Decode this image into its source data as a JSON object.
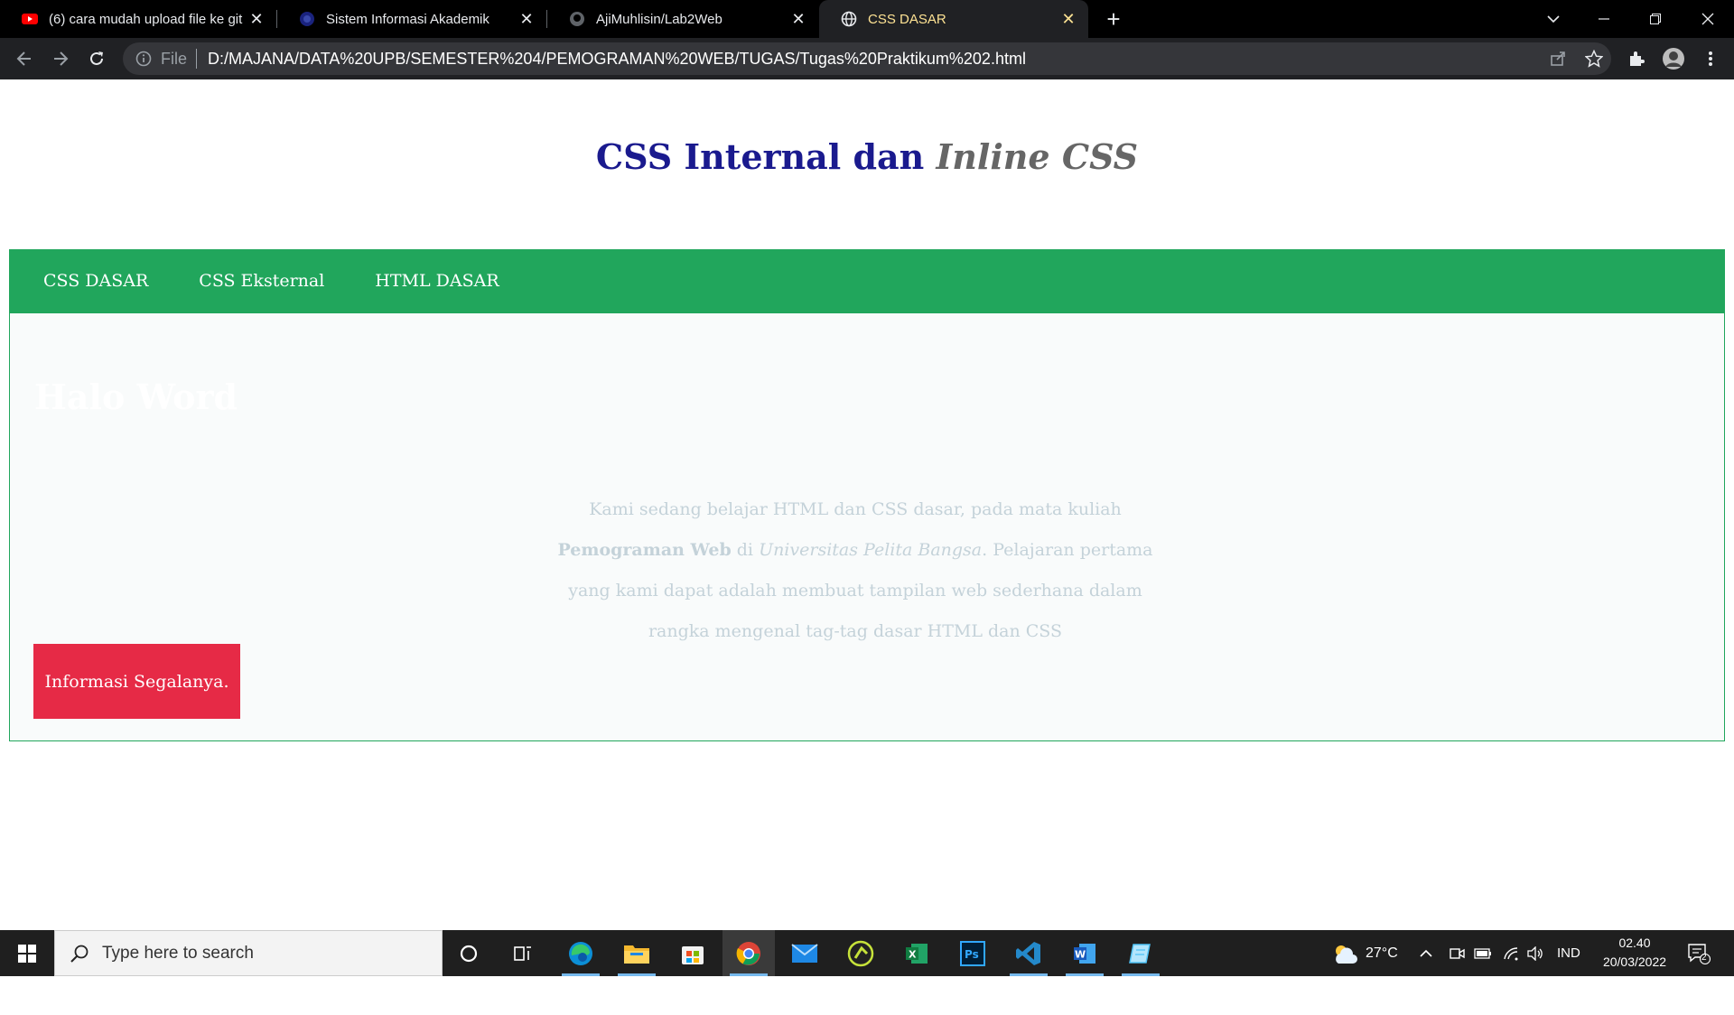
{
  "browser": {
    "tabs": [
      {
        "title": "(6) cara mudah upload file ke git",
        "icon": "youtube-icon"
      },
      {
        "title": "Sistem Informasi Akademik",
        "icon": "site-logo-icon"
      },
      {
        "title": "AjiMuhlisin/Lab2Web",
        "icon": "github-icon"
      },
      {
        "title": "CSS DASAR",
        "icon": "globe-icon",
        "active": true
      }
    ],
    "file_label": "File",
    "url": "D:/MAJANA/DATA%20UPB/SEMESTER%204/PEMOGRAMAN%20WEB/TUGAS/Tugas%20Praktikum%202.html"
  },
  "page": {
    "title_main": "CSS Internal dan ",
    "title_italic": "Inline CSS",
    "nav": [
      "CSS DASAR",
      "CSS Eksternal",
      "HTML DASAR"
    ],
    "hello": "Halo Word",
    "intro": {
      "part1": "Kami sedang belajar HTML dan CSS dasar, pada mata kuliah ",
      "bold": "Pemograman Web",
      "part2": " di ",
      "italic": "Universitas Pelita Bangsa",
      "part3": ". Pelajaran pertama yang kami dapat adalah membuat tampilan web sederhana dalam rangka mengenal tag-tag dasar HTML dan CSS"
    },
    "button": "Informasi Segalanya."
  },
  "taskbar": {
    "search_placeholder": "Type here to search",
    "apps": [
      "cortana-icon",
      "task-view-icon",
      "edge-icon",
      "file-explorer-icon",
      "store-icon",
      "chrome-icon",
      "mail-icon",
      "app-icon",
      "excel-icon",
      "photoshop-icon",
      "vscode-icon",
      "word-icon",
      "notepad-icon"
    ],
    "weather": "27°C",
    "language": "IND",
    "time": "02.40",
    "date": "20/03/2022",
    "notifications": "2"
  },
  "colors": {
    "nav_green": "#21a65c",
    "button_red": "#e62a46",
    "title_blue": "#1a1a8e"
  }
}
